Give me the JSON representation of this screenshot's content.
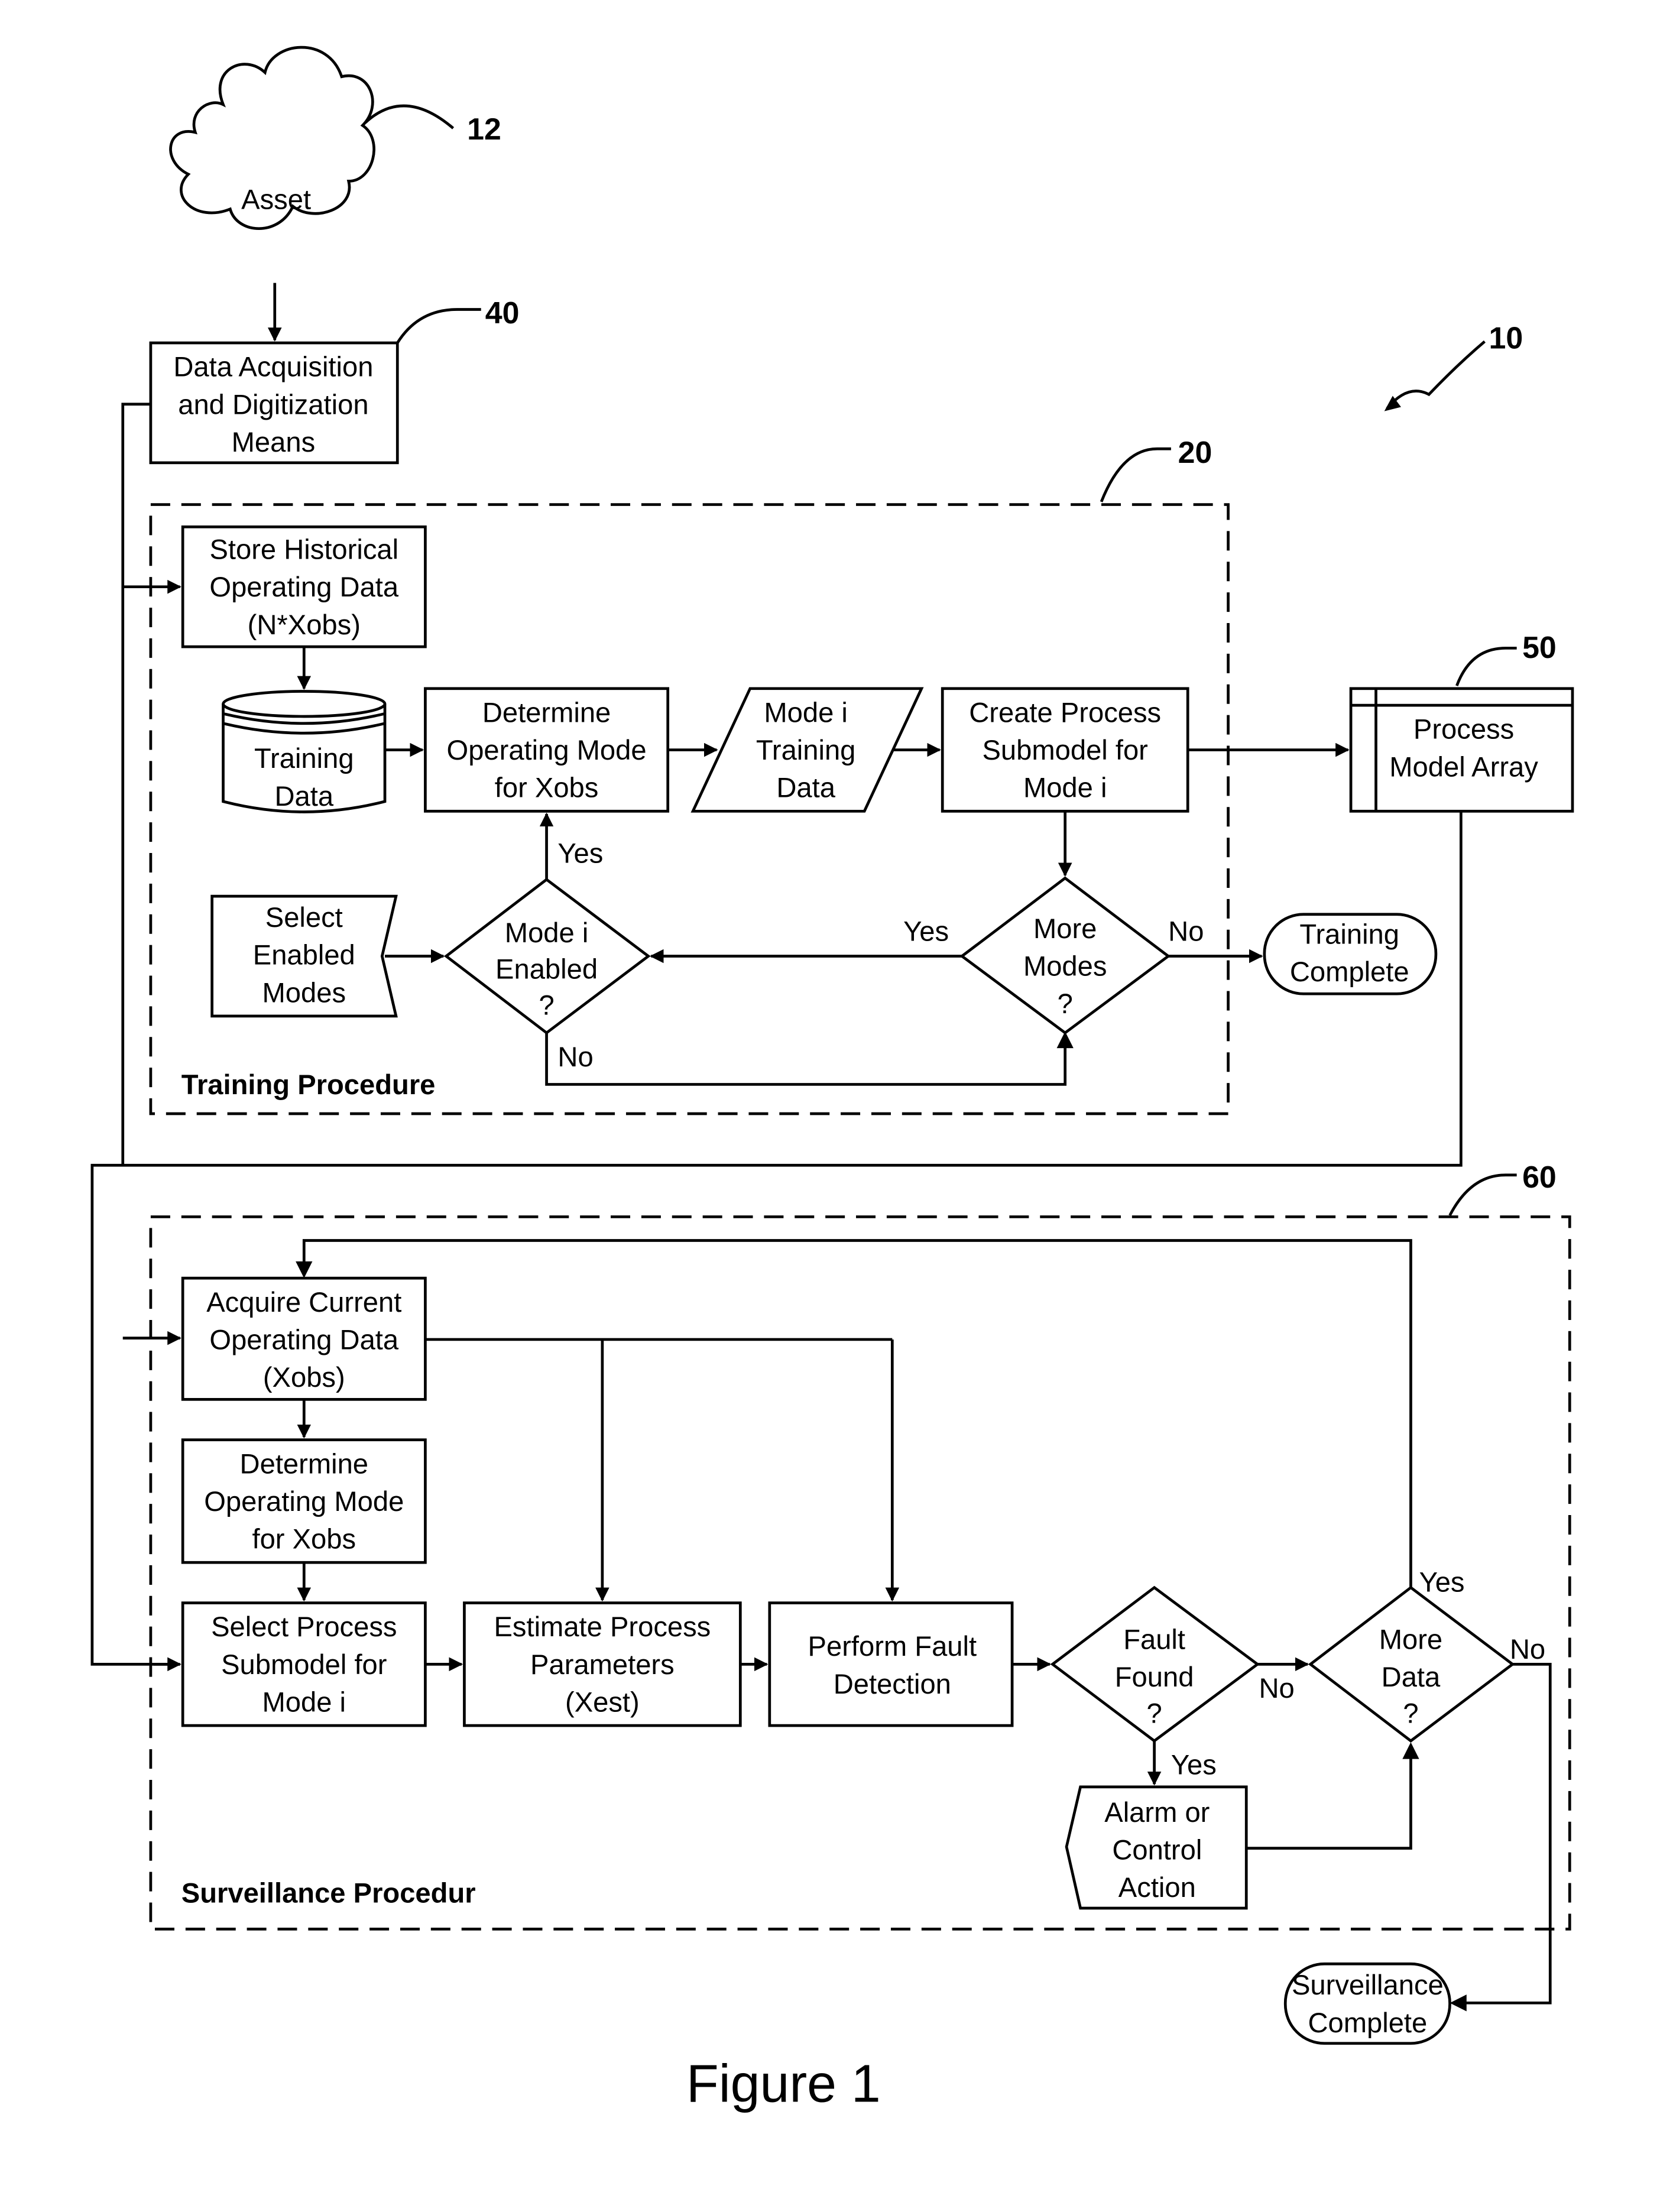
{
  "refs": {
    "asset": "12",
    "acq": "40",
    "system": "10",
    "training": "20",
    "array": "50",
    "surveillance": "60"
  },
  "asset": "Asset",
  "acq": [
    "Data Acquisition",
    "and Digitization",
    "Means"
  ],
  "training": {
    "title": "Training Procedure",
    "store": [
      "Store Historical",
      "Operating Data",
      "(N*Xobs)"
    ],
    "db": [
      "Training",
      "Data"
    ],
    "determine": [
      "Determine",
      "Operating Mode",
      "for Xobs"
    ],
    "mode_data": [
      "Mode i",
      "Training",
      "Data"
    ],
    "create": [
      "Create Process",
      "Submodel for",
      "Mode i"
    ],
    "select": [
      "Select",
      "Enabled",
      "Modes"
    ],
    "enabled": [
      "Mode i",
      "Enabled",
      "?"
    ],
    "more": [
      "More",
      "Modes",
      "?"
    ],
    "complete": [
      "Training",
      "Complete"
    ],
    "yes": "Yes",
    "no": "No"
  },
  "array": [
    "Process",
    "Model Array"
  ],
  "surveillance": {
    "title": "Surveillance  Procedur",
    "acquire": [
      "Acquire Current",
      "Operating Data",
      "(Xobs)"
    ],
    "determine": [
      "Determine",
      "Operating Mode",
      "for Xobs"
    ],
    "select": [
      "Select Process",
      "Submodel for",
      "Mode i"
    ],
    "estimate": [
      "Estimate Process",
      "Parameters",
      "(Xest)"
    ],
    "fault_detect": [
      "Perform Fault",
      "Detection"
    ],
    "fault_found": [
      "Fault",
      "Found",
      "?"
    ],
    "alarm": [
      "Alarm or",
      "Control",
      "Action"
    ],
    "more": [
      "More",
      "Data",
      "?"
    ],
    "complete": [
      "Surveillance",
      "Complete"
    ],
    "yes": "Yes",
    "no": "No"
  },
  "caption": "Figure 1"
}
